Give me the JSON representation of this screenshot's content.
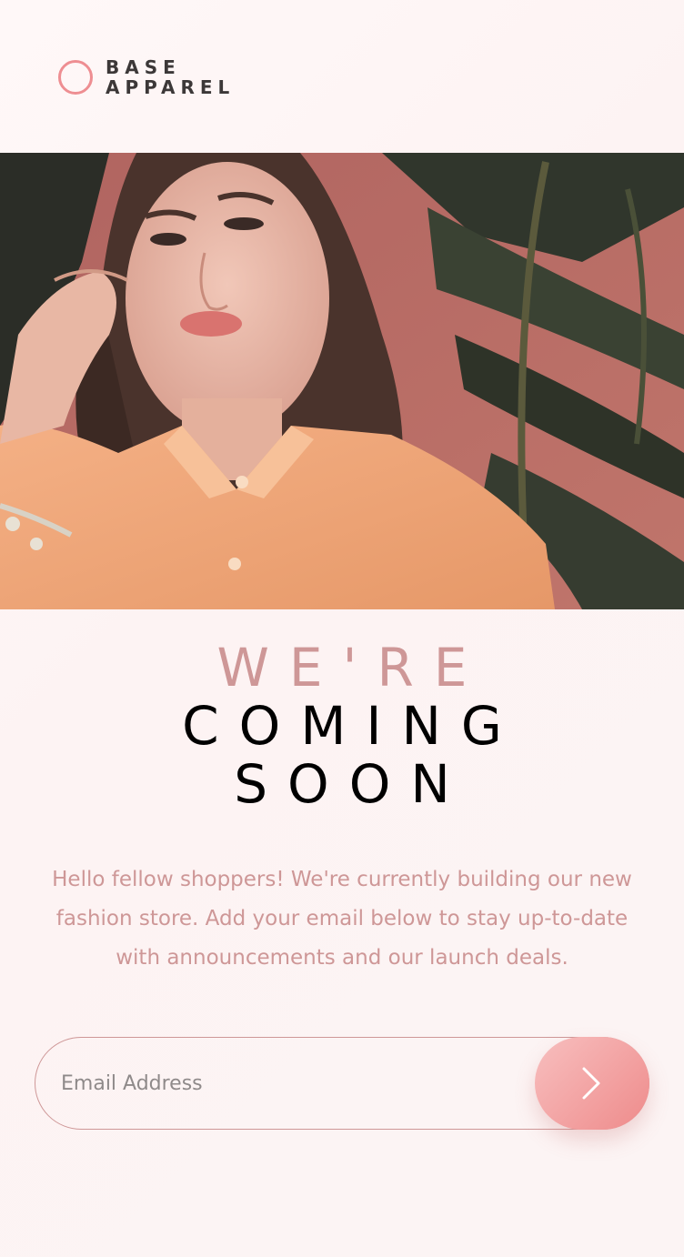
{
  "brand": {
    "line1": "BASE",
    "line2": "APPAREL",
    "accent_color": "#ee8e92"
  },
  "hero": {
    "image_icon": "hero-photo"
  },
  "headline": {
    "light": "WE'RE",
    "dark_line1": "COMING",
    "dark_line2": "SOON"
  },
  "description": "Hello fellow shoppers! We're currently building our new fashion store. Add your email below to stay up-to-date with announcements and our launch deals.",
  "form": {
    "email_placeholder": "Email Address",
    "email_value": "",
    "submit_icon": "chevron-right-icon"
  },
  "colors": {
    "text_pink": "#ce9797",
    "button_gradient_start": "#f8bfbf",
    "button_gradient_end": "#ee8b8b"
  }
}
